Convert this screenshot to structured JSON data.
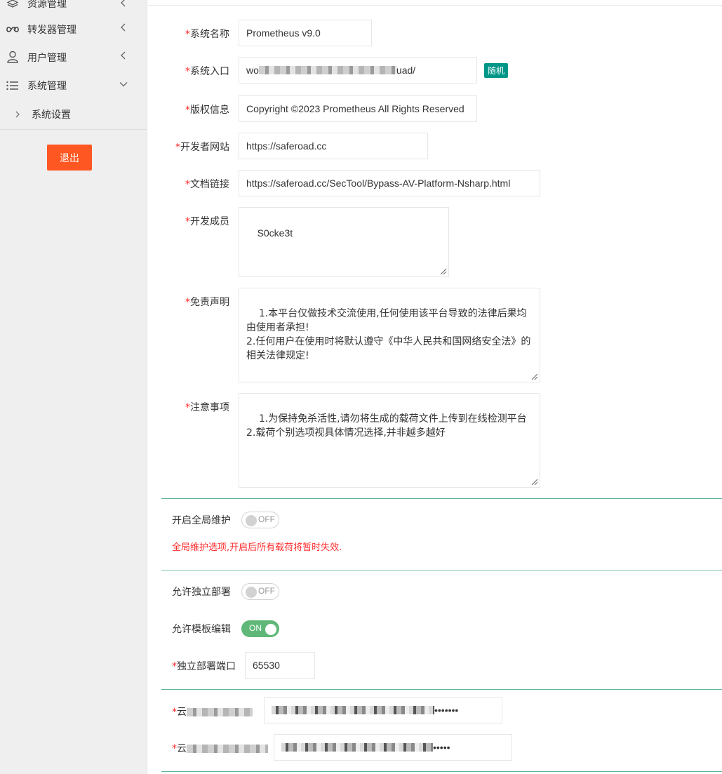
{
  "sidebar": {
    "items": [
      {
        "label": "资源管理",
        "icon": "layers-icon"
      },
      {
        "label": "转发器管理",
        "icon": "link-icon"
      },
      {
        "label": "用户管理",
        "icon": "user-icon"
      },
      {
        "label": "系统管理",
        "icon": "list-icon"
      }
    ],
    "sub_items": [
      {
        "label": "系统设置"
      }
    ],
    "logout_label": "退出"
  },
  "form": {
    "required_mark": "*",
    "system_name": {
      "label": "系统名称",
      "value": "Prometheus v9.0"
    },
    "system_entry": {
      "label": "系统入口",
      "value_prefix": "wo",
      "value_suffix": "uad/",
      "random_label": "随机"
    },
    "copyright": {
      "label": "版权信息",
      "value": "Copyright ©2023 Prometheus All Rights Reserved"
    },
    "dev_site": {
      "label": "开发者网站",
      "value": "https://saferoad.cc"
    },
    "doc_link": {
      "label": "文档链接",
      "value": "https://saferoad.cc/SecTool/Bypass-AV-Platform-Nsharp.html"
    },
    "developers": {
      "label": "开发成员",
      "value": "S0cke3t"
    },
    "disclaimer": {
      "label": "免责声明",
      "value": "1.本平台仅做技术交流使用,任何使用该平台导致的法律后果均由使用者承担!\n2.任何用户在使用时将默认遵守《中华人民共和国网络安全法》的相关法律规定!"
    },
    "notes": {
      "label": "注意事项",
      "value": "1.为保持免杀活性,请勿将生成的载荷文件上传到在线检测平台\n2.载荷个别选项视具体情况选择,并非越多越好"
    },
    "global_maintenance": {
      "label": "开启全局维护",
      "state": "OFF",
      "warning": "全局维护选项,开启后所有载荷将暂时失效."
    },
    "standalone_deploy": {
      "label": "允许独立部署",
      "state": "OFF"
    },
    "template_edit": {
      "label": "允许模板编辑",
      "state": "ON"
    },
    "deploy_port": {
      "label": "独立部署端口",
      "value": "65530"
    },
    "cloud_field_1": {
      "label_prefix": "云",
      "value_mask": "•••••••"
    },
    "cloud_field_2": {
      "label_prefix": "云",
      "value_mask": "•••••"
    }
  }
}
